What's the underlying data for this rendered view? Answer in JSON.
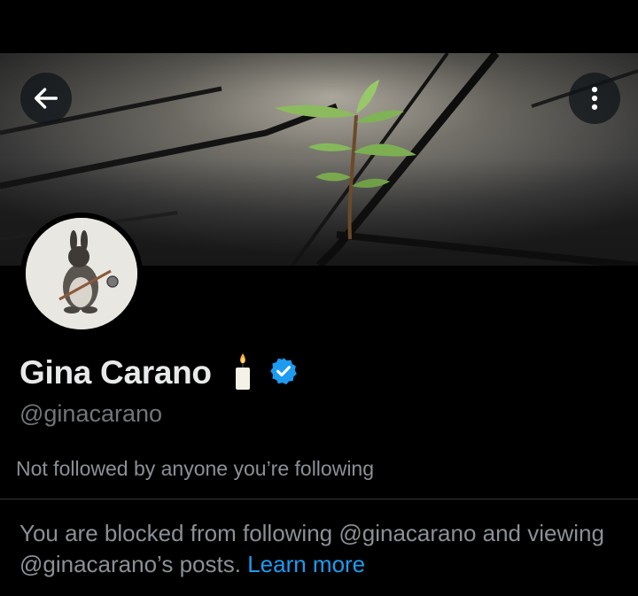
{
  "header": {
    "back_icon": "arrow-left-icon",
    "more_icon": "more-vertical-icon"
  },
  "banner": {
    "image": "seedling-growing-through-pavement"
  },
  "profile": {
    "display_name": "Gina Carano",
    "name_emoji": "candle",
    "verified_icon": "verified-badge-icon",
    "handle": "@ginacarano",
    "followed_by": "Not followed by anyone you’re following",
    "avatar_image": "rabbit-with-flail-drawing"
  },
  "notice": {
    "text": "You are blocked from following @ginacarano and viewing @ginacarano’s posts.",
    "link_label": "Learn more"
  },
  "colors": {
    "background": "#000000",
    "primary_text": "#e7e9ea",
    "secondary_text": "#71767b",
    "link": "#1d9bf0",
    "verified": "#1d9bf0"
  }
}
